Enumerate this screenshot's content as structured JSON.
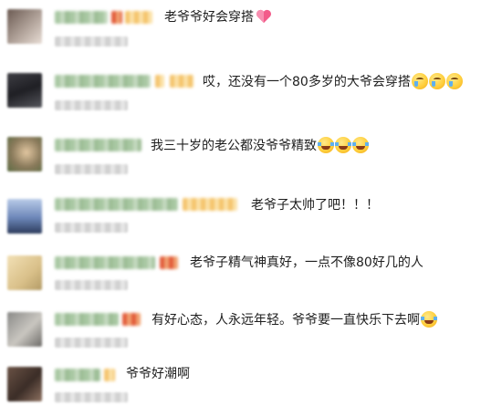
{
  "comments": [
    {
      "text": "老爷爷好会穿搭",
      "emojis": [
        "heart-icon"
      ]
    },
    {
      "text": "哎，还没有一个80多岁的大爷会穿搭",
      "emojis": [
        "crying-face-icon",
        "crying-face-icon",
        "crying-face-icon"
      ]
    },
    {
      "text": "我三十岁的老公都没爷爷精致",
      "emojis": [
        "laughing-crying-face-icon",
        "laughing-crying-face-icon",
        "laughing-crying-face-icon"
      ]
    },
    {
      "text": "老爷子太帅了吧！！！",
      "emojis": []
    },
    {
      "text": "老爷子精气神真好，一点不像80好几的人",
      "emojis": []
    },
    {
      "text": "有好心态，人永远年轻。爷爷要一直快乐下去啊",
      "emojis": [
        "laughing-crying-face-icon"
      ]
    },
    {
      "text": "爷爷好潮啊",
      "emojis": []
    }
  ],
  "colors": {
    "name_blur": "#a9c8a3",
    "badge_blur": "#f4c36b",
    "meta_blur": "#d2d2d2",
    "text": "#1e1e1e"
  }
}
